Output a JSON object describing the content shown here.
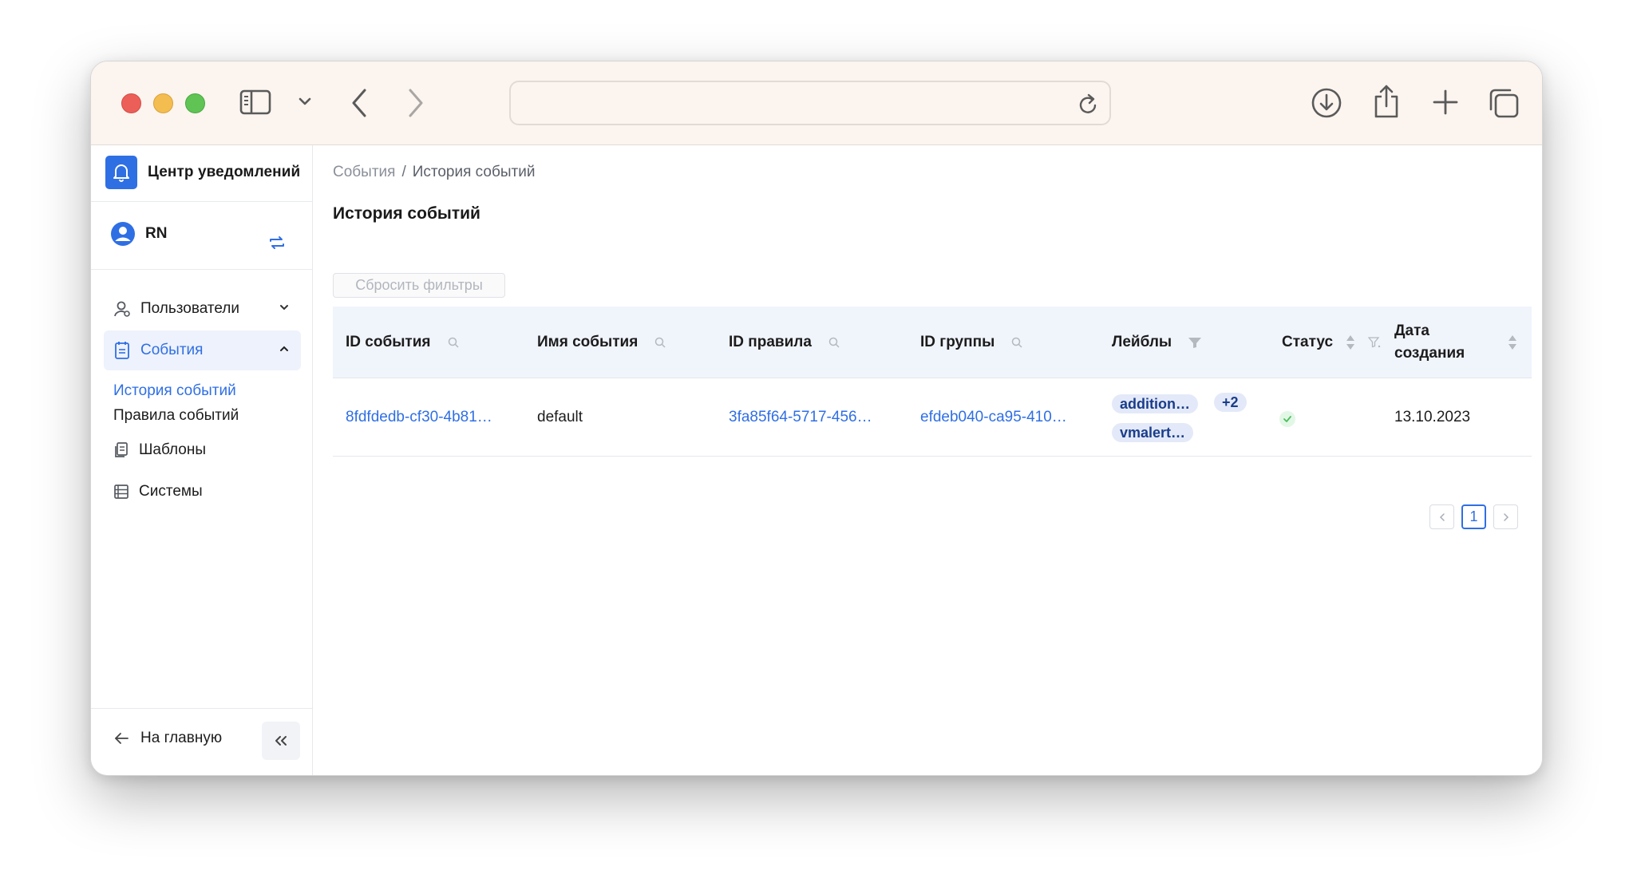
{
  "browser": {
    "address_value": "",
    "address_placeholder": ""
  },
  "sidebar": {
    "brand_title": "Центр уведомлений",
    "user_initials": "RN",
    "nav": {
      "users": "Пользователи",
      "events": "События",
      "events_sub": [
        "История событий",
        "Правила событий"
      ],
      "templates": "Шаблоны",
      "systems": "Системы"
    },
    "home_link": "На главную"
  },
  "main": {
    "breadcrumb": {
      "parent": "События",
      "separator": "/",
      "current": "История событий"
    },
    "title": "История событий",
    "reset_filters": "Сбросить фильтры",
    "table": {
      "columns": [
        "ID события",
        "Имя события",
        "ID правила",
        "ID группы",
        "Лейблы",
        "Статус",
        "Дата",
        "создания"
      ],
      "rows": [
        {
          "event_id": "8fdfdedb-cf30-4b81…",
          "event_name": "default",
          "rule_id": "3fa85f64-5717-456…",
          "group_id": "efdeb040-ca95-410…",
          "labels": [
            "addition…",
            "vmalert…"
          ],
          "labels_more": "+2",
          "status": "success",
          "created": "13.10.2023"
        }
      ]
    },
    "pagination": {
      "current_page": "1"
    }
  },
  "colors": {
    "accent": "#2f6fe4",
    "header_bg": "#f0f4fb",
    "toolbar_bg": "#fbf4ef",
    "status_ok": "#4cbf5e"
  },
  "icons": [
    "sidebar-toggle-icon",
    "chevron-down-icon",
    "back-icon",
    "forward-icon",
    "reload-icon",
    "download-icon",
    "share-icon",
    "plus-icon",
    "tabs-icon",
    "bell-icon",
    "user-icon",
    "switch-icon",
    "users-icon",
    "events-icon",
    "templates-icon",
    "systems-icon",
    "arrow-left-icon",
    "double-chevron-left-icon",
    "search-icon",
    "filter-icon",
    "sort-icon",
    "check-icon"
  ]
}
